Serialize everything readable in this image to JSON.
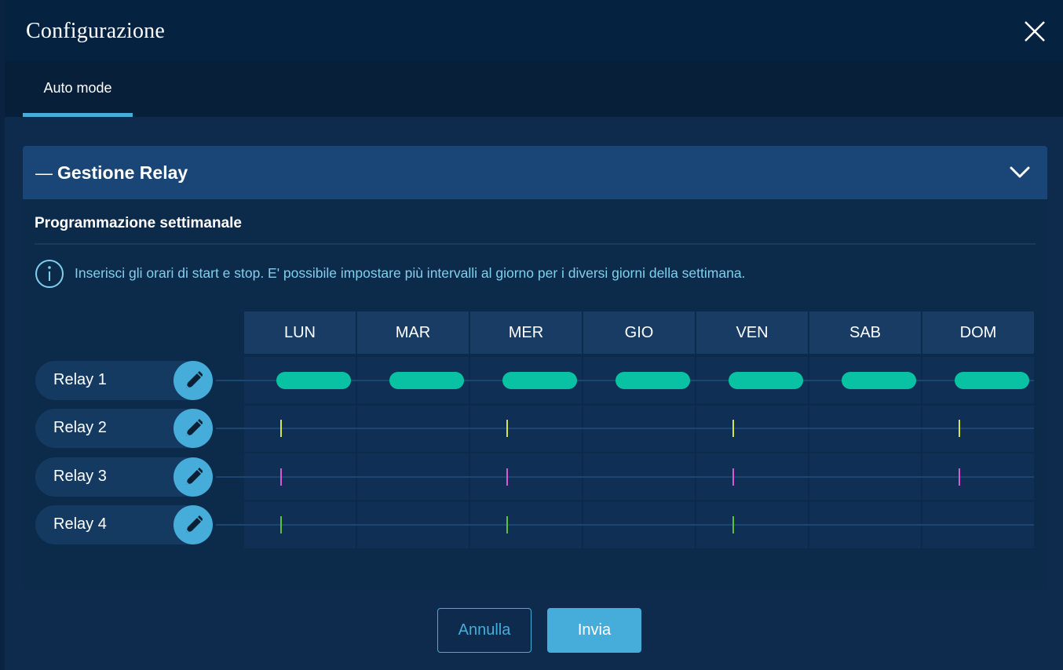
{
  "modal": {
    "title": "Configurazione",
    "close_icon": "close-icon"
  },
  "tabs": [
    {
      "label": "Auto mode",
      "active": true
    }
  ],
  "panel": {
    "title": "Gestione Relay",
    "collapse_icon": "minus-icon",
    "chevron_icon": "chevron-down-icon",
    "section_title": "Programmazione settimanale",
    "info_icon": "info-icon",
    "info_text": "Inserisci gli orari di start e stop. E' possibile impostare più intervalli al giorno per i diversi giorni della settimana."
  },
  "schedule": {
    "days": [
      "LUN",
      "MAR",
      "MER",
      "GIO",
      "VEN",
      "SAB",
      "DOM"
    ],
    "relays": [
      {
        "label": "Relay 1",
        "edit_icon": "pencil-icon",
        "mark": "bar",
        "color": "#09c2a3",
        "active_days": [
          0,
          1,
          2,
          3,
          4,
          5,
          6
        ]
      },
      {
        "label": "Relay 2",
        "edit_icon": "pencil-icon",
        "mark": "tick",
        "color": "#d7e34a",
        "active_days": [
          0,
          2,
          4,
          6
        ]
      },
      {
        "label": "Relay 3",
        "edit_icon": "pencil-icon",
        "mark": "tick",
        "color": "#d85ad8",
        "active_days": [
          0,
          2,
          4,
          6
        ]
      },
      {
        "label": "Relay 4",
        "edit_icon": "pencil-icon",
        "mark": "tick",
        "color": "#5ac23c",
        "active_days": [
          0,
          2,
          4
        ]
      }
    ]
  },
  "actions": {
    "cancel_label": "Annulla",
    "submit_label": "Invia"
  },
  "colors": {
    "accent": "#46acd9",
    "header_bg": "#052240",
    "panel_head_bg": "#1a4677"
  }
}
